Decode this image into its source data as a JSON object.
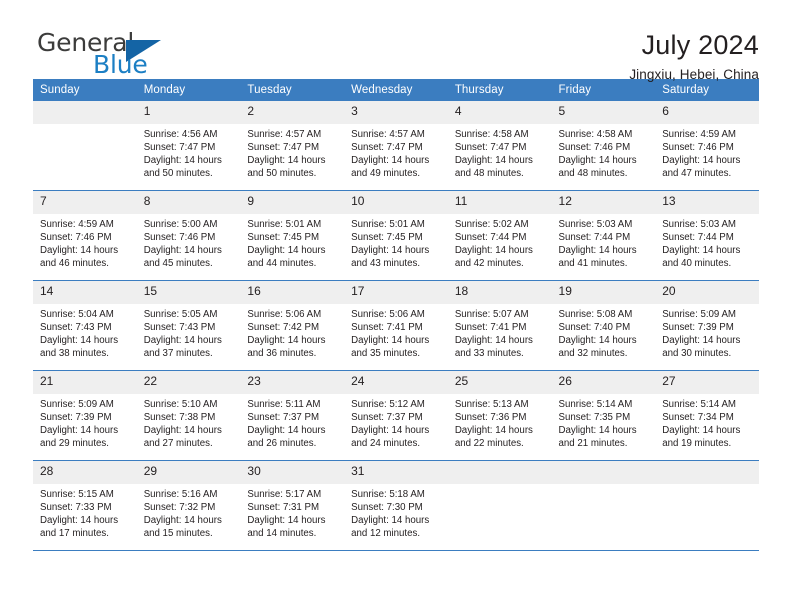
{
  "brand": {
    "name_top": "General",
    "name_bottom": "Blue",
    "triangle_color": "#1464a5",
    "blue_color": "#1c7fc4",
    "gray_color": "#3c3c3b"
  },
  "header": {
    "title": "July 2024",
    "subtitle": "Jingxiu, Hebei, China"
  },
  "theme": {
    "header_blue": "#3b7dc0",
    "daynum_band": "#efefef",
    "text": "#231f20"
  },
  "weekdays": [
    "Sunday",
    "Monday",
    "Tuesday",
    "Wednesday",
    "Thursday",
    "Friday",
    "Saturday"
  ],
  "weeks": [
    [
      {
        "day": "",
        "sunrise": "",
        "sunset": "",
        "daylight_line1": "",
        "daylight_line2": ""
      },
      {
        "day": "1",
        "sunrise": "Sunrise: 4:56 AM",
        "sunset": "Sunset: 7:47 PM",
        "daylight_line1": "Daylight: 14 hours",
        "daylight_line2": "and 50 minutes."
      },
      {
        "day": "2",
        "sunrise": "Sunrise: 4:57 AM",
        "sunset": "Sunset: 7:47 PM",
        "daylight_line1": "Daylight: 14 hours",
        "daylight_line2": "and 50 minutes."
      },
      {
        "day": "3",
        "sunrise": "Sunrise: 4:57 AM",
        "sunset": "Sunset: 7:47 PM",
        "daylight_line1": "Daylight: 14 hours",
        "daylight_line2": "and 49 minutes."
      },
      {
        "day": "4",
        "sunrise": "Sunrise: 4:58 AM",
        "sunset": "Sunset: 7:47 PM",
        "daylight_line1": "Daylight: 14 hours",
        "daylight_line2": "and 48 minutes."
      },
      {
        "day": "5",
        "sunrise": "Sunrise: 4:58 AM",
        "sunset": "Sunset: 7:46 PM",
        "daylight_line1": "Daylight: 14 hours",
        "daylight_line2": "and 48 minutes."
      },
      {
        "day": "6",
        "sunrise": "Sunrise: 4:59 AM",
        "sunset": "Sunset: 7:46 PM",
        "daylight_line1": "Daylight: 14 hours",
        "daylight_line2": "and 47 minutes."
      }
    ],
    [
      {
        "day": "7",
        "sunrise": "Sunrise: 4:59 AM",
        "sunset": "Sunset: 7:46 PM",
        "daylight_line1": "Daylight: 14 hours",
        "daylight_line2": "and 46 minutes."
      },
      {
        "day": "8",
        "sunrise": "Sunrise: 5:00 AM",
        "sunset": "Sunset: 7:46 PM",
        "daylight_line1": "Daylight: 14 hours",
        "daylight_line2": "and 45 minutes."
      },
      {
        "day": "9",
        "sunrise": "Sunrise: 5:01 AM",
        "sunset": "Sunset: 7:45 PM",
        "daylight_line1": "Daylight: 14 hours",
        "daylight_line2": "and 44 minutes."
      },
      {
        "day": "10",
        "sunrise": "Sunrise: 5:01 AM",
        "sunset": "Sunset: 7:45 PM",
        "daylight_line1": "Daylight: 14 hours",
        "daylight_line2": "and 43 minutes."
      },
      {
        "day": "11",
        "sunrise": "Sunrise: 5:02 AM",
        "sunset": "Sunset: 7:44 PM",
        "daylight_line1": "Daylight: 14 hours",
        "daylight_line2": "and 42 minutes."
      },
      {
        "day": "12",
        "sunrise": "Sunrise: 5:03 AM",
        "sunset": "Sunset: 7:44 PM",
        "daylight_line1": "Daylight: 14 hours",
        "daylight_line2": "and 41 minutes."
      },
      {
        "day": "13",
        "sunrise": "Sunrise: 5:03 AM",
        "sunset": "Sunset: 7:44 PM",
        "daylight_line1": "Daylight: 14 hours",
        "daylight_line2": "and 40 minutes."
      }
    ],
    [
      {
        "day": "14",
        "sunrise": "Sunrise: 5:04 AM",
        "sunset": "Sunset: 7:43 PM",
        "daylight_line1": "Daylight: 14 hours",
        "daylight_line2": "and 38 minutes."
      },
      {
        "day": "15",
        "sunrise": "Sunrise: 5:05 AM",
        "sunset": "Sunset: 7:43 PM",
        "daylight_line1": "Daylight: 14 hours",
        "daylight_line2": "and 37 minutes."
      },
      {
        "day": "16",
        "sunrise": "Sunrise: 5:06 AM",
        "sunset": "Sunset: 7:42 PM",
        "daylight_line1": "Daylight: 14 hours",
        "daylight_line2": "and 36 minutes."
      },
      {
        "day": "17",
        "sunrise": "Sunrise: 5:06 AM",
        "sunset": "Sunset: 7:41 PM",
        "daylight_line1": "Daylight: 14 hours",
        "daylight_line2": "and 35 minutes."
      },
      {
        "day": "18",
        "sunrise": "Sunrise: 5:07 AM",
        "sunset": "Sunset: 7:41 PM",
        "daylight_line1": "Daylight: 14 hours",
        "daylight_line2": "and 33 minutes."
      },
      {
        "day": "19",
        "sunrise": "Sunrise: 5:08 AM",
        "sunset": "Sunset: 7:40 PM",
        "daylight_line1": "Daylight: 14 hours",
        "daylight_line2": "and 32 minutes."
      },
      {
        "day": "20",
        "sunrise": "Sunrise: 5:09 AM",
        "sunset": "Sunset: 7:39 PM",
        "daylight_line1": "Daylight: 14 hours",
        "daylight_line2": "and 30 minutes."
      }
    ],
    [
      {
        "day": "21",
        "sunrise": "Sunrise: 5:09 AM",
        "sunset": "Sunset: 7:39 PM",
        "daylight_line1": "Daylight: 14 hours",
        "daylight_line2": "and 29 minutes."
      },
      {
        "day": "22",
        "sunrise": "Sunrise: 5:10 AM",
        "sunset": "Sunset: 7:38 PM",
        "daylight_line1": "Daylight: 14 hours",
        "daylight_line2": "and 27 minutes."
      },
      {
        "day": "23",
        "sunrise": "Sunrise: 5:11 AM",
        "sunset": "Sunset: 7:37 PM",
        "daylight_line1": "Daylight: 14 hours",
        "daylight_line2": "and 26 minutes."
      },
      {
        "day": "24",
        "sunrise": "Sunrise: 5:12 AM",
        "sunset": "Sunset: 7:37 PM",
        "daylight_line1": "Daylight: 14 hours",
        "daylight_line2": "and 24 minutes."
      },
      {
        "day": "25",
        "sunrise": "Sunrise: 5:13 AM",
        "sunset": "Sunset: 7:36 PM",
        "daylight_line1": "Daylight: 14 hours",
        "daylight_line2": "and 22 minutes."
      },
      {
        "day": "26",
        "sunrise": "Sunrise: 5:14 AM",
        "sunset": "Sunset: 7:35 PM",
        "daylight_line1": "Daylight: 14 hours",
        "daylight_line2": "and 21 minutes."
      },
      {
        "day": "27",
        "sunrise": "Sunrise: 5:14 AM",
        "sunset": "Sunset: 7:34 PM",
        "daylight_line1": "Daylight: 14 hours",
        "daylight_line2": "and 19 minutes."
      }
    ],
    [
      {
        "day": "28",
        "sunrise": "Sunrise: 5:15 AM",
        "sunset": "Sunset: 7:33 PM",
        "daylight_line1": "Daylight: 14 hours",
        "daylight_line2": "and 17 minutes."
      },
      {
        "day": "29",
        "sunrise": "Sunrise: 5:16 AM",
        "sunset": "Sunset: 7:32 PM",
        "daylight_line1": "Daylight: 14 hours",
        "daylight_line2": "and 15 minutes."
      },
      {
        "day": "30",
        "sunrise": "Sunrise: 5:17 AM",
        "sunset": "Sunset: 7:31 PM",
        "daylight_line1": "Daylight: 14 hours",
        "daylight_line2": "and 14 minutes."
      },
      {
        "day": "31",
        "sunrise": "Sunrise: 5:18 AM",
        "sunset": "Sunset: 7:30 PM",
        "daylight_line1": "Daylight: 14 hours",
        "daylight_line2": "and 12 minutes."
      },
      {
        "day": "",
        "sunrise": "",
        "sunset": "",
        "daylight_line1": "",
        "daylight_line2": ""
      },
      {
        "day": "",
        "sunrise": "",
        "sunset": "",
        "daylight_line1": "",
        "daylight_line2": ""
      },
      {
        "day": "",
        "sunrise": "",
        "sunset": "",
        "daylight_line1": "",
        "daylight_line2": ""
      }
    ]
  ]
}
